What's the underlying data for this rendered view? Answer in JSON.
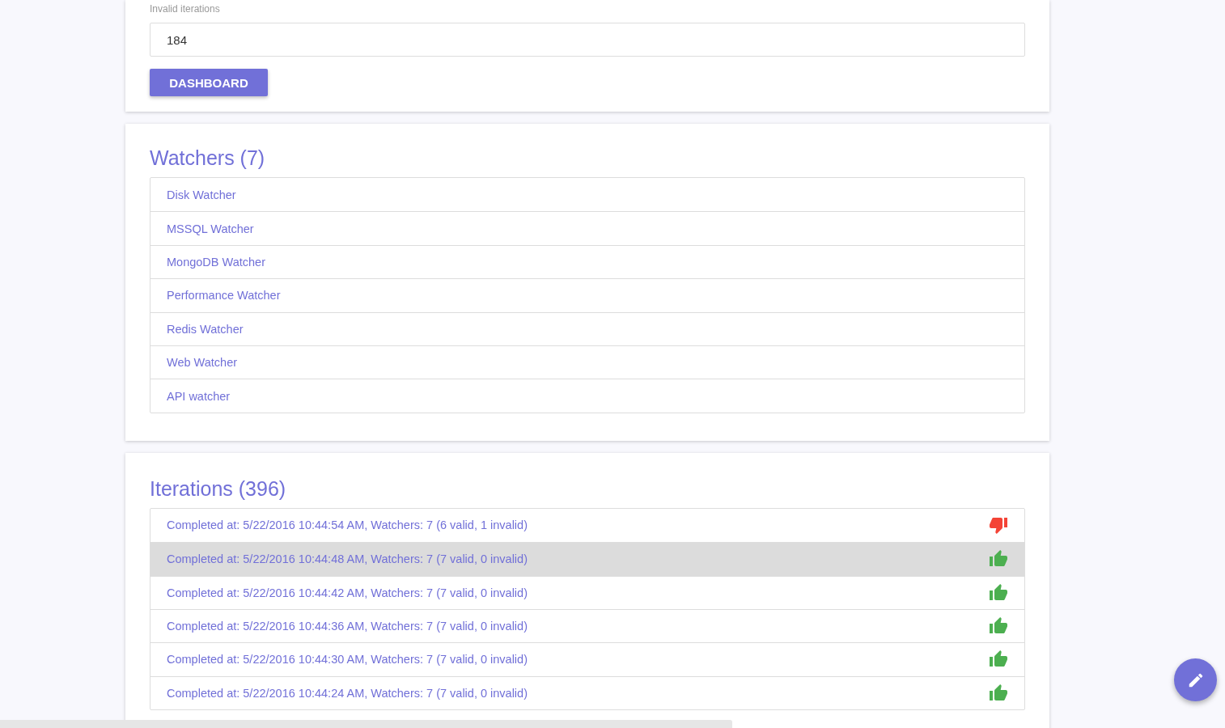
{
  "settings_card": {
    "field_label": "Invalid iterations",
    "field_value": "184",
    "button": "DASHBOARD"
  },
  "watchers": {
    "title": "Watchers (7)",
    "items": [
      {
        "label": "Disk Watcher"
      },
      {
        "label": "MSSQL Watcher"
      },
      {
        "label": "MongoDB Watcher"
      },
      {
        "label": "Performance Watcher"
      },
      {
        "label": "Redis Watcher"
      },
      {
        "label": "Web Watcher"
      },
      {
        "label": "API watcher"
      }
    ]
  },
  "iterations": {
    "title": "Iterations (396)",
    "items": [
      {
        "label": "Completed at: 5/22/2016 10:44:54 AM, Watchers: 7 (6 valid, 1 invalid)",
        "valid": false,
        "selected": false
      },
      {
        "label": "Completed at: 5/22/2016 10:44:48 AM, Watchers: 7 (7 valid, 0 invalid)",
        "valid": true,
        "selected": true
      },
      {
        "label": "Completed at: 5/22/2016 10:44:42 AM, Watchers: 7 (7 valid, 0 invalid)",
        "valid": true,
        "selected": false
      },
      {
        "label": "Completed at: 5/22/2016 10:44:36 AM, Watchers: 7 (7 valid, 0 invalid)",
        "valid": true,
        "selected": false
      },
      {
        "label": "Completed at: 5/22/2016 10:44:30 AM, Watchers: 7 (7 valid, 0 invalid)",
        "valid": true,
        "selected": false
      },
      {
        "label": "Completed at: 5/22/2016 10:44:24 AM, Watchers: 7 (7 valid, 0 invalid)",
        "valid": true,
        "selected": false
      }
    ]
  }
}
